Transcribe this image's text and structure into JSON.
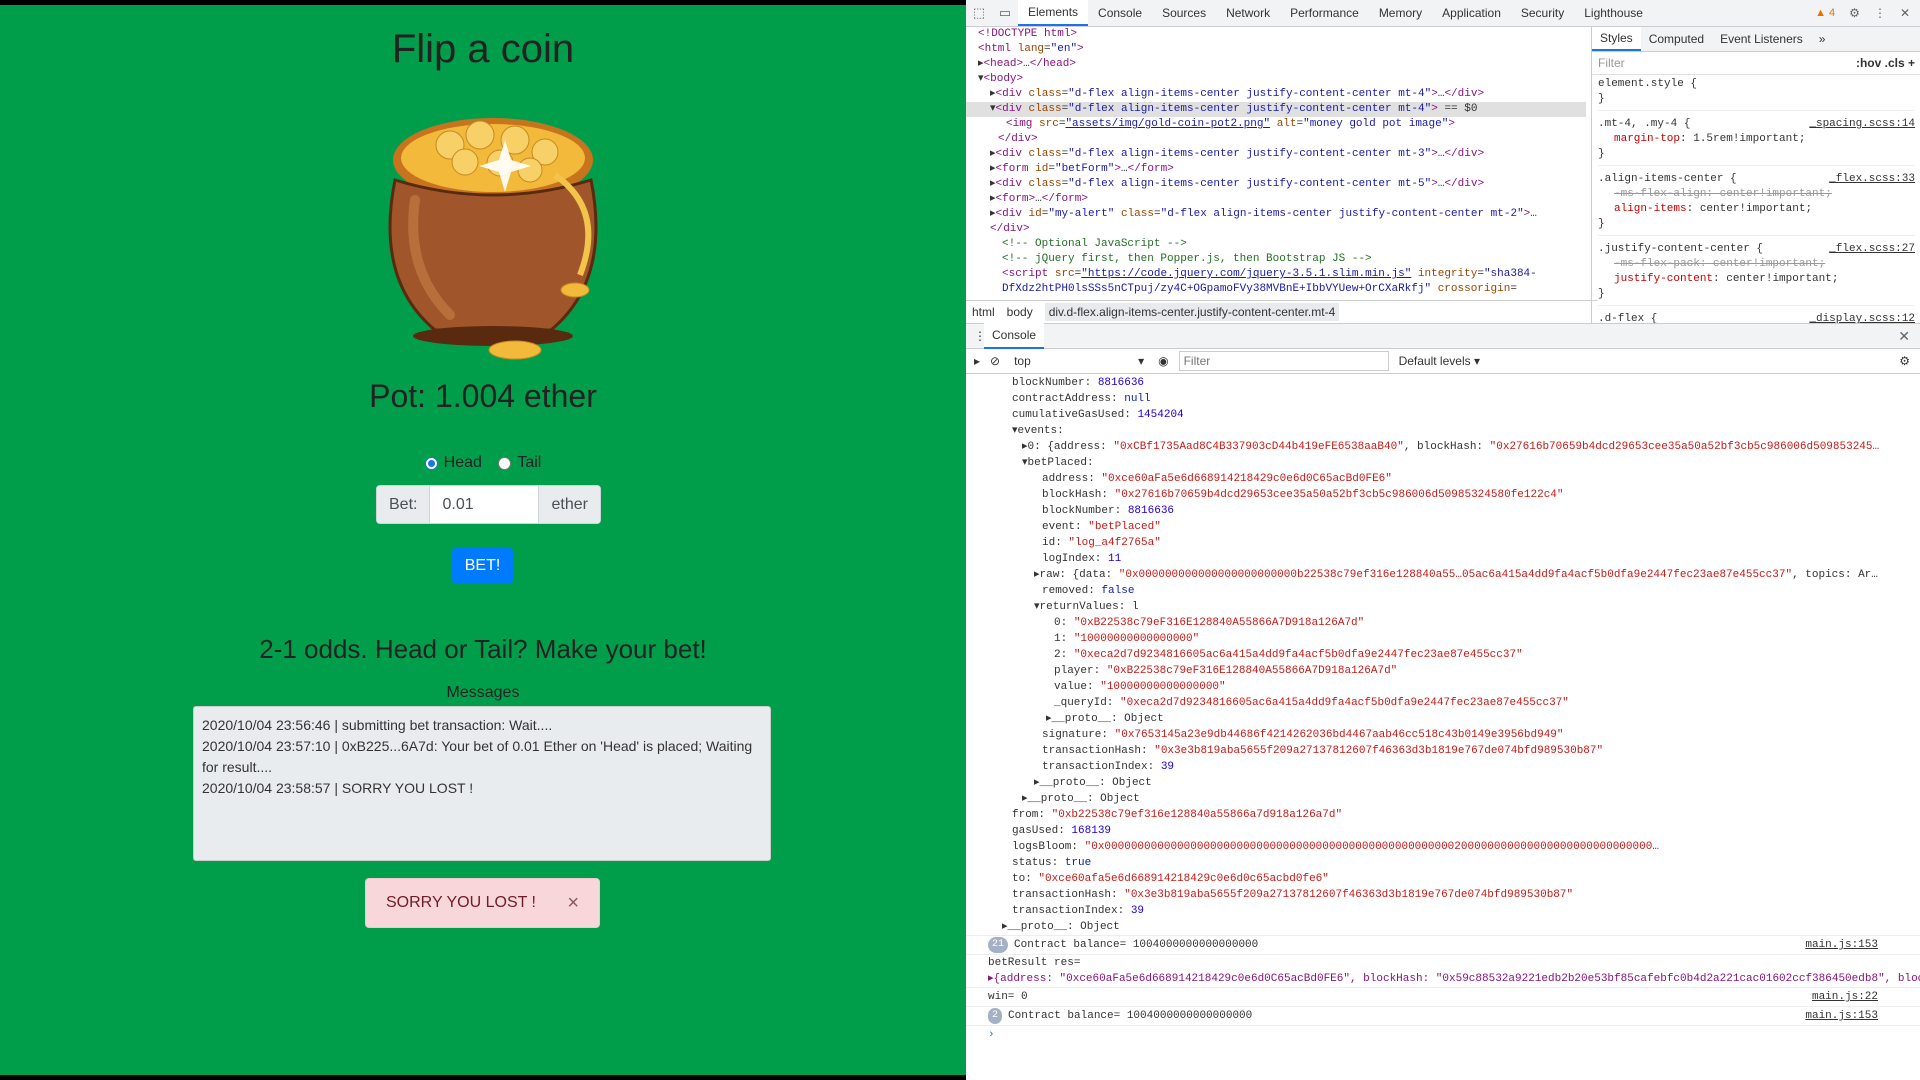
{
  "app": {
    "title": "Flip a coin",
    "pot_text": "Pot: 1.004 ether",
    "radio_head": "Head",
    "radio_tail": "Tail",
    "bet_prefix": "Bet:",
    "bet_value": "0.01",
    "bet_suffix": "ether",
    "bet_button": "BET!",
    "odds_text": "2-1 odds. Head or Tail? Make your bet!",
    "messages_label": "Messages",
    "messages": [
      "2020/10/04 23:56:46 | submitting bet transaction: Wait....",
      "2020/10/04 23:57:10 | 0xB225...6A7d: Your bet of 0.01 Ether on 'Head' is placed; Waiting for result....",
      "2020/10/04 23:58:57 | SORRY YOU LOST !"
    ],
    "alert_text": "SORRY YOU LOST !",
    "alert_close": "×"
  },
  "devtools": {
    "tabs": [
      "Elements",
      "Console",
      "Sources",
      "Network",
      "Performance",
      "Memory",
      "Application",
      "Security",
      "Lighthouse"
    ],
    "warning_count": "4",
    "styles_tabs": [
      "Styles",
      "Computed",
      "Event Listeners"
    ],
    "styles_filter_placeholder": "Filter",
    "styles_hov": ":hov",
    "styles_cls": ".cls",
    "breadcrumb": [
      "html",
      "body",
      "div.d-flex.align-items-center.justify-content-center.mt-4"
    ],
    "console_tab": "Console",
    "console_context": "top",
    "console_filter_placeholder": "Filter",
    "console_levels": "Default levels"
  }
}
